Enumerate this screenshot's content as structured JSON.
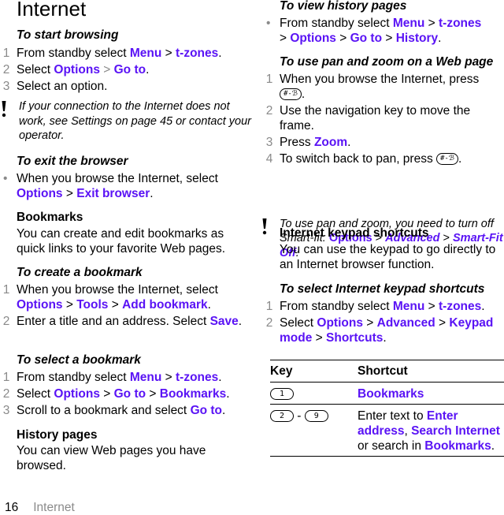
{
  "page": {
    "title": "Internet",
    "footer": {
      "page_number": "16",
      "section": "Internet"
    }
  },
  "colors": {
    "link": "#5a13f5",
    "step_number": "#8a8a8a",
    "text": "#000000"
  },
  "left": {
    "start_browsing": {
      "title": "To start browsing",
      "steps": [
        {
          "num": "1",
          "pre": "From standby select ",
          "p1": "Menu",
          "s1": " > ",
          "p2": "t-zones",
          "post": "."
        },
        {
          "num": "2",
          "pre": "Select ",
          "p1": "Options",
          "s1": " > ",
          "p2": "Go to",
          "post": "."
        },
        {
          "num": "3",
          "text": "Select an option."
        }
      ]
    },
    "note1": {
      "icon": "exclamation-icon",
      "text": "If your connection to the Internet does not work, see Settings on page 45 or contact your operator."
    },
    "exit_browser": {
      "title": "To exit the browser",
      "bullet": "•",
      "pre": "When you browse the Internet, select ",
      "p1": "Options",
      "s1": " > ",
      "p2": "Exit browser",
      "post": "."
    },
    "bookmarks": {
      "heading": "Bookmarks",
      "body": "You can create and edit bookmarks as quick links to your favorite Web pages."
    },
    "create_bookmark": {
      "title": "To create a bookmark",
      "steps": [
        {
          "num": "1",
          "pre": "When you browse the Internet, select ",
          "p1": "Options",
          "s1": " > ",
          "p2": "Tools",
          "s2": " > ",
          "p3": "Add bookmark",
          "post": "."
        },
        {
          "num": "2",
          "pre": "Enter a title and an address. Select ",
          "p1": "Save",
          "post": "."
        }
      ]
    },
    "select_bookmark": {
      "title": "To select a bookmark",
      "steps": [
        {
          "num": "1",
          "pre": "From standby select ",
          "p1": "Menu",
          "s1": " > ",
          "p2": "t-zones",
          "post": "."
        },
        {
          "num": "2",
          "pre": "Select ",
          "p1": "Options",
          "s1": " > ",
          "p2": "Go to",
          "s2": " > ",
          "p3": "Bookmarks",
          "post": "."
        },
        {
          "num": "3",
          "pre": "Scroll to a bookmark and select ",
          "p1": "Go to",
          "post": "."
        }
      ]
    },
    "history": {
      "heading": "History pages",
      "body": "You can view Web pages you have browsed."
    }
  },
  "right": {
    "view_history": {
      "title": "To view history pages",
      "bullet": "•",
      "pre": "From standby select ",
      "p1": "Menu",
      "s1": " > ",
      "p2": "t-zones",
      "s2": " > ",
      "p3": "Options",
      "s3": " > ",
      "p4": "Go to",
      "s4": " > ",
      "p5": "History",
      "post": "."
    },
    "pan_zoom": {
      "title": "To use pan and zoom on a Web page",
      "steps": [
        {
          "num": "1",
          "pre": "When you browse the Internet, press ",
          "key": "#-ℬ",
          "post": "."
        },
        {
          "num": "2",
          "text": "Use the navigation key to move the frame."
        },
        {
          "num": "3",
          "pre": "Press ",
          "p1": "Zoom",
          "post": "."
        },
        {
          "num": "4",
          "pre": "To switch back to pan, press ",
          "key": "#-ℬ",
          "post": "."
        }
      ]
    },
    "note2": {
      "icon": "exclamation-icon",
      "pre": "To use pan and zoom, you need to turn off Smart-fit: ",
      "p1": "Options",
      "s1": " > ",
      "p2": "Advanced",
      "s2": " > ",
      "p3": "Smart-Fit",
      "s3": " > ",
      "p4": "Off",
      "post": "."
    },
    "keypad": {
      "heading": "Internet keypad shortcuts",
      "body": "You can use the keypad to go directly to an Internet browser function."
    },
    "select_keypad": {
      "title": "To select Internet keypad shortcuts",
      "steps": [
        {
          "num": "1",
          "pre": "From standby select ",
          "p1": "Menu",
          "s1": " > ",
          "p2": "t-zones",
          "post": "."
        },
        {
          "num": "2",
          "pre": "Select ",
          "p1": "Options",
          "s1": " > ",
          "p2": "Advanced",
          "s2": " > ",
          "p3": "Keypad mode",
          "s3": " > ",
          "p4": "Shortcuts",
          "post": "."
        }
      ]
    },
    "table": {
      "headers": [
        "Key",
        "Shortcut"
      ],
      "rows": [
        {
          "key1": "1",
          "shortcut": {
            "p1": "Bookmarks"
          }
        },
        {
          "key1": "2",
          "dash": " - ",
          "key2": "9",
          "shortcut": {
            "pre": "Enter text to ",
            "p1": "Enter address",
            "s1": ", ",
            "p2": "Search Internet",
            "mid": " or search in ",
            "p3": "Bookmarks",
            "post": "."
          }
        }
      ]
    }
  }
}
